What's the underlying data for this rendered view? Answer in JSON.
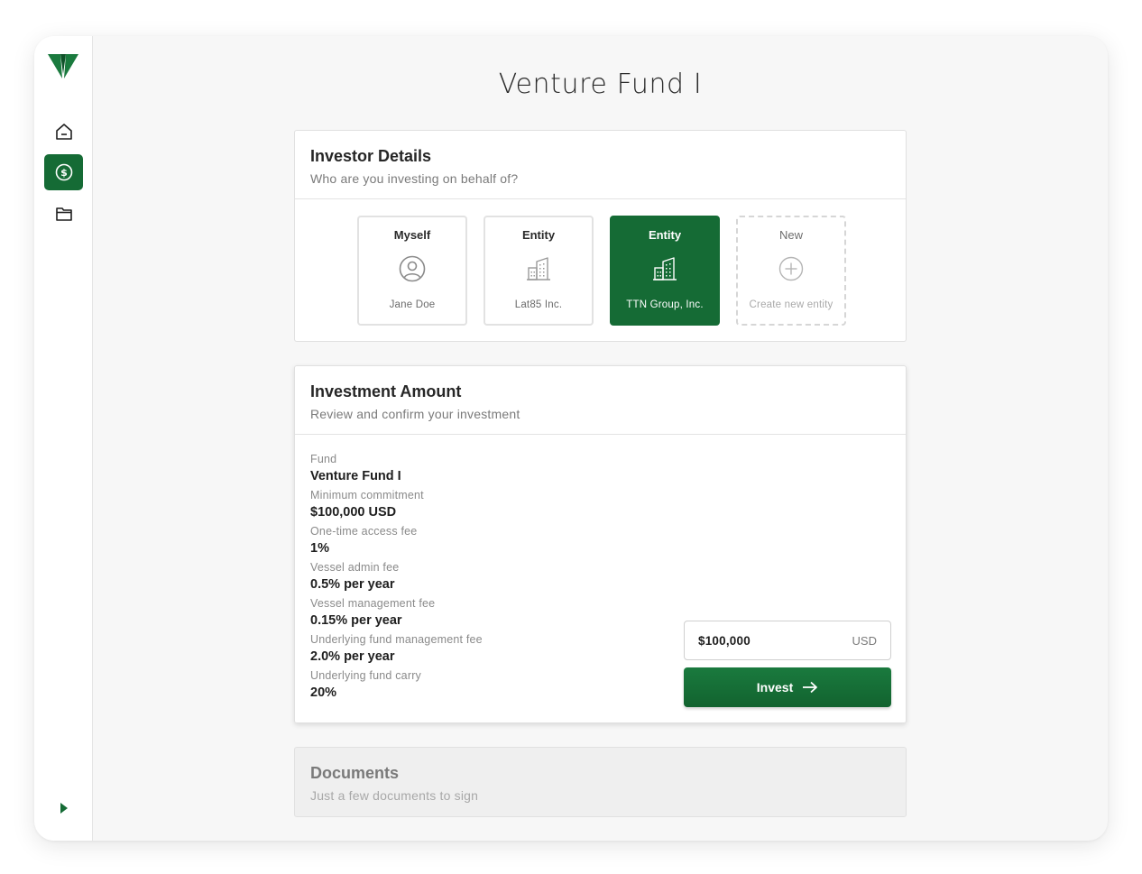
{
  "colors": {
    "accent": "#156b35",
    "accent_dark": "#12632f",
    "muted": "#7a7a7a"
  },
  "page": {
    "title": "Venture Fund I"
  },
  "sidebar": {
    "items": [
      {
        "icon": "home-icon",
        "active": false
      },
      {
        "icon": "dollar-icon",
        "active": true
      },
      {
        "icon": "folder-icon",
        "active": false
      }
    ],
    "expand_icon": "caret-right-icon"
  },
  "investor_details": {
    "title": "Investor Details",
    "subtitle": "Who are you investing on behalf of?",
    "options": [
      {
        "label": "Myself",
        "name": "Jane Doe",
        "icon": "user-circle-icon",
        "selected": false
      },
      {
        "label": "Entity",
        "name": "Lat85 Inc.",
        "icon": "building-icon",
        "selected": false
      },
      {
        "label": "Entity",
        "name": "TTN Group, Inc.",
        "icon": "building-icon",
        "selected": true
      },
      {
        "label": "New",
        "name": "Create new entity",
        "icon": "plus-circle-icon",
        "selected": false
      }
    ]
  },
  "investment_amount": {
    "title": "Investment Amount",
    "subtitle": "Review and confirm your investment",
    "fees": [
      {
        "label": "Fund",
        "value": "Venture Fund I"
      },
      {
        "label": "Minimum commitment",
        "value": "$100,000 USD"
      },
      {
        "label": "One-time access fee",
        "value": "1%"
      },
      {
        "label": "Vessel admin fee",
        "value": "0.5% per year"
      },
      {
        "label": "Vessel management fee",
        "value": "0.15% per year"
      },
      {
        "label": "Underlying fund management fee",
        "value": "2.0% per year"
      },
      {
        "label": "Underlying fund carry",
        "value": "20%"
      }
    ],
    "amount_value": "$100,000",
    "currency": "USD",
    "invest_label": "Invest"
  },
  "documents": {
    "title": "Documents",
    "subtitle": "Just a few documents to sign"
  }
}
